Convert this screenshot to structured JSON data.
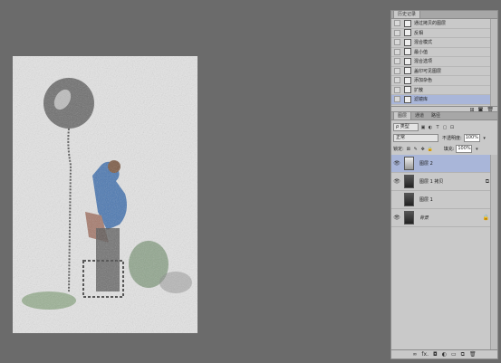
{
  "history": {
    "tab_label": "历史记录",
    "items": [
      {
        "label": "通过拷贝的图层",
        "selected": false
      },
      {
        "label": "反相",
        "selected": false
      },
      {
        "label": "混合模式",
        "selected": false
      },
      {
        "label": "最小值",
        "selected": false
      },
      {
        "label": "混合选项",
        "selected": false
      },
      {
        "label": "盖印可见图层",
        "selected": false
      },
      {
        "label": "添加杂色",
        "selected": false
      },
      {
        "label": "扩散",
        "selected": false
      },
      {
        "label": "滤镜库",
        "selected": true
      }
    ],
    "footer_icons": [
      "new-document-icon",
      "snapshot-icon",
      "trash-icon"
    ]
  },
  "layers": {
    "tabs": [
      "图层",
      "通道",
      "路径"
    ],
    "filter_kind": "ρ 类型",
    "blend_mode": "正常",
    "opacity_label": "不透明度:",
    "opacity_value": "100%",
    "lock_label": "锁定:",
    "fill_label": "填充:",
    "fill_value": "100%",
    "items": [
      {
        "name": "图层 2",
        "visible": true,
        "selected": true,
        "thumb": "light",
        "italic": false,
        "end_icon": ""
      },
      {
        "name": "图层 1 拷贝",
        "visible": true,
        "selected": false,
        "thumb": "dark",
        "italic": false,
        "end_icon": "⧉"
      },
      {
        "name": "图层 1",
        "visible": false,
        "selected": false,
        "thumb": "dark",
        "italic": false,
        "end_icon": ""
      },
      {
        "name": "背景",
        "visible": true,
        "selected": false,
        "thumb": "dark",
        "italic": true,
        "end_icon": "🔒"
      }
    ],
    "footer_icons": [
      "∞",
      "fx.",
      "◘",
      "◐",
      "▭",
      "⧉",
      "🗑"
    ]
  }
}
